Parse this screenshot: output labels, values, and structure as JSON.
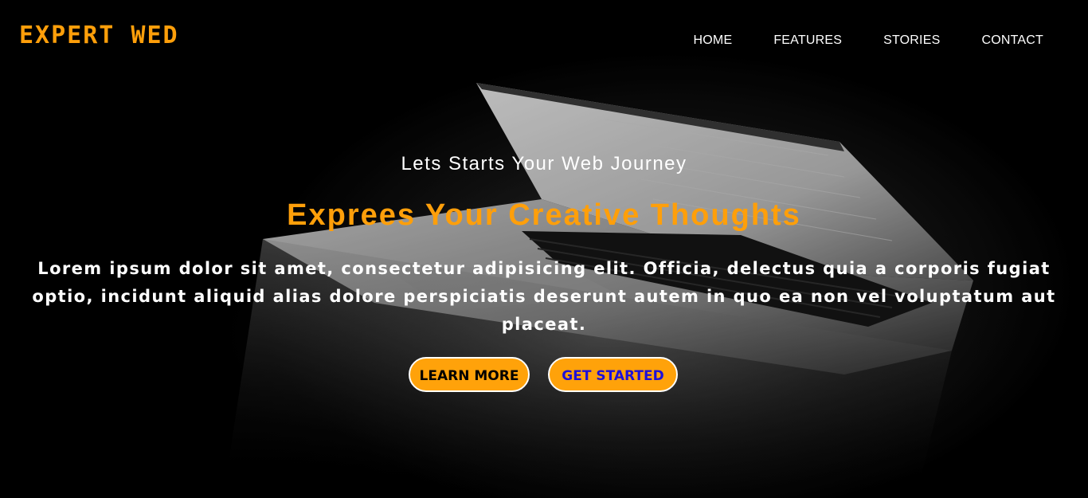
{
  "nav": {
    "brand": "EXPERT WED",
    "links": [
      {
        "label": "HOME"
      },
      {
        "label": "FEATURES"
      },
      {
        "label": "STORIES"
      },
      {
        "label": "CONTACT"
      }
    ]
  },
  "hero": {
    "tagline": "Lets Starts Your Web Journey",
    "headline": "Exprees Your Creative Thoughts",
    "description": "Lorem ipsum dolor sit amet, consectetur adipisicing elit. Officia, delectus quia a corporis fugiat optio, incidunt aliquid alias dolore perspiciatis deserunt autem in quo ea non vel voluptatum aut placeat.",
    "buttons": {
      "learn_more": "LEARN MORE",
      "get_started": "GET STARTED"
    },
    "background_image": "laptop-photo"
  },
  "colors": {
    "accent": "#ff9f0a",
    "background": "#000000",
    "text": "#ffffff",
    "get_started_text": "#1d10d8"
  }
}
